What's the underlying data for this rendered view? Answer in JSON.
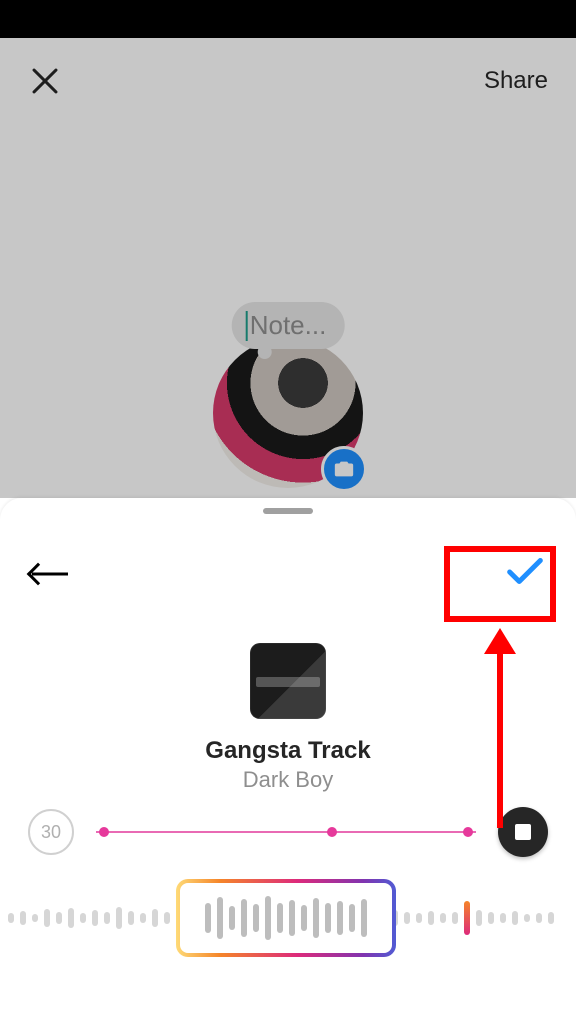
{
  "header": {
    "share_label": "Share"
  },
  "note": {
    "placeholder": "Note..."
  },
  "sheet": {
    "track_title": "Gangsta Track",
    "track_artist": "Dark Boy",
    "duration_label": "30"
  },
  "colors": {
    "highlight": "#ff0000",
    "accent": "#1f8fff"
  }
}
